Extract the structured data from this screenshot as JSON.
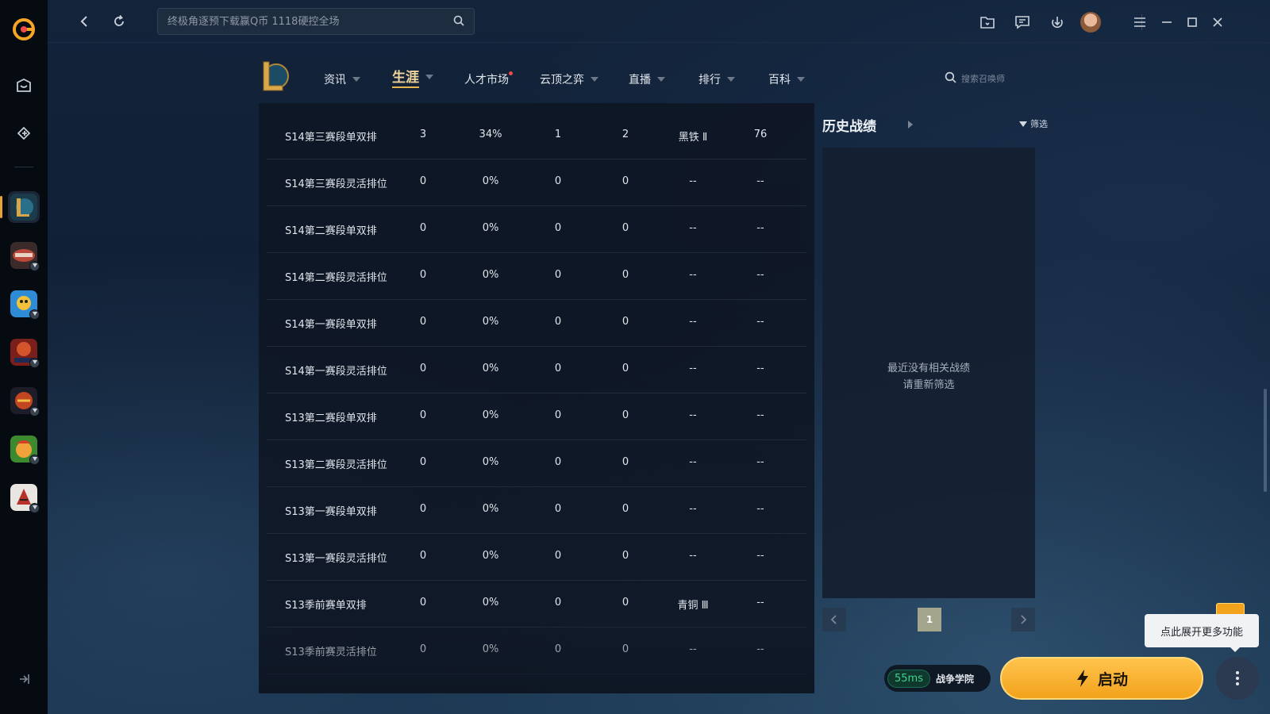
{
  "search": {
    "placeholder": "终极角逐预下载赢Q币 1118硬控全场"
  },
  "nav": [
    {
      "label": "资讯",
      "caret": true,
      "active": false,
      "dot": false
    },
    {
      "label": "生涯",
      "caret": true,
      "active": true,
      "dot": false
    },
    {
      "label": "人才市场",
      "caret": false,
      "active": false,
      "dot": true
    },
    {
      "label": "云顶之弈",
      "caret": true,
      "active": false,
      "dot": false
    },
    {
      "label": "直播",
      "caret": true,
      "active": false,
      "dot": false
    },
    {
      "label": "排行",
      "caret": true,
      "active": false,
      "dot": false
    },
    {
      "label": "百科",
      "caret": true,
      "active": false,
      "dot": false
    }
  ],
  "summoner_search": {
    "placeholder": "搜索召唤师"
  },
  "ranked_rows": [
    {
      "name": "S14第三赛段单双排",
      "games": "3",
      "winrate": "34%",
      "c3": "1",
      "c4": "2",
      "tier": "黑铁 Ⅱ",
      "score": "76"
    },
    {
      "name": "S14第三赛段灵活排位",
      "games": "0",
      "winrate": "0%",
      "c3": "0",
      "c4": "0",
      "tier": "--",
      "score": "--"
    },
    {
      "name": "S14第二赛段单双排",
      "games": "0",
      "winrate": "0%",
      "c3": "0",
      "c4": "0",
      "tier": "--",
      "score": "--"
    },
    {
      "name": "S14第二赛段灵活排位",
      "games": "0",
      "winrate": "0%",
      "c3": "0",
      "c4": "0",
      "tier": "--",
      "score": "--"
    },
    {
      "name": "S14第一赛段单双排",
      "games": "0",
      "winrate": "0%",
      "c3": "0",
      "c4": "0",
      "tier": "--",
      "score": "--"
    },
    {
      "name": "S14第一赛段灵活排位",
      "games": "0",
      "winrate": "0%",
      "c3": "0",
      "c4": "0",
      "tier": "--",
      "score": "--"
    },
    {
      "name": "S13第二赛段单双排",
      "games": "0",
      "winrate": "0%",
      "c3": "0",
      "c4": "0",
      "tier": "--",
      "score": "--"
    },
    {
      "name": "S13第二赛段灵活排位",
      "games": "0",
      "winrate": "0%",
      "c3": "0",
      "c4": "0",
      "tier": "--",
      "score": "--"
    },
    {
      "name": "S13第一赛段单双排",
      "games": "0",
      "winrate": "0%",
      "c3": "0",
      "c4": "0",
      "tier": "--",
      "score": "--"
    },
    {
      "name": "S13第一赛段灵活排位",
      "games": "0",
      "winrate": "0%",
      "c3": "0",
      "c4": "0",
      "tier": "--",
      "score": "--"
    },
    {
      "name": "S13季前赛单双排",
      "games": "0",
      "winrate": "0%",
      "c3": "0",
      "c4": "0",
      "tier": "青铜 Ⅲ",
      "score": "--"
    },
    {
      "name": "S13季前赛灵活排位",
      "games": "0",
      "winrate": "0%",
      "c3": "0",
      "c4": "0",
      "tier": "--",
      "score": "--"
    }
  ],
  "history": {
    "title": "历史战绩",
    "filter_label": "筛选",
    "empty_line1": "最近没有相关战绩",
    "empty_line2": "请重新筛选",
    "page": "1"
  },
  "status": {
    "ping": "55ms",
    "server": "战争学院"
  },
  "launch_label": "启动",
  "tooltip": "点此展开更多功能",
  "colors": {
    "accent": "#f3a21c",
    "active_tab": "#f0d69a",
    "ping_green": "#3fd18e"
  },
  "icons": [
    "wegame-logo",
    "store-bag-icon",
    "game-controller-icon",
    "lol-logo",
    "back-arrow-icon",
    "refresh-icon",
    "search-icon",
    "folder-icon",
    "message-icon",
    "download-icon",
    "menu-icon",
    "minimize-icon",
    "maximize-icon",
    "close-icon",
    "filter-icon",
    "bolt-icon",
    "more-vertical-icon",
    "collapse-icon"
  ]
}
